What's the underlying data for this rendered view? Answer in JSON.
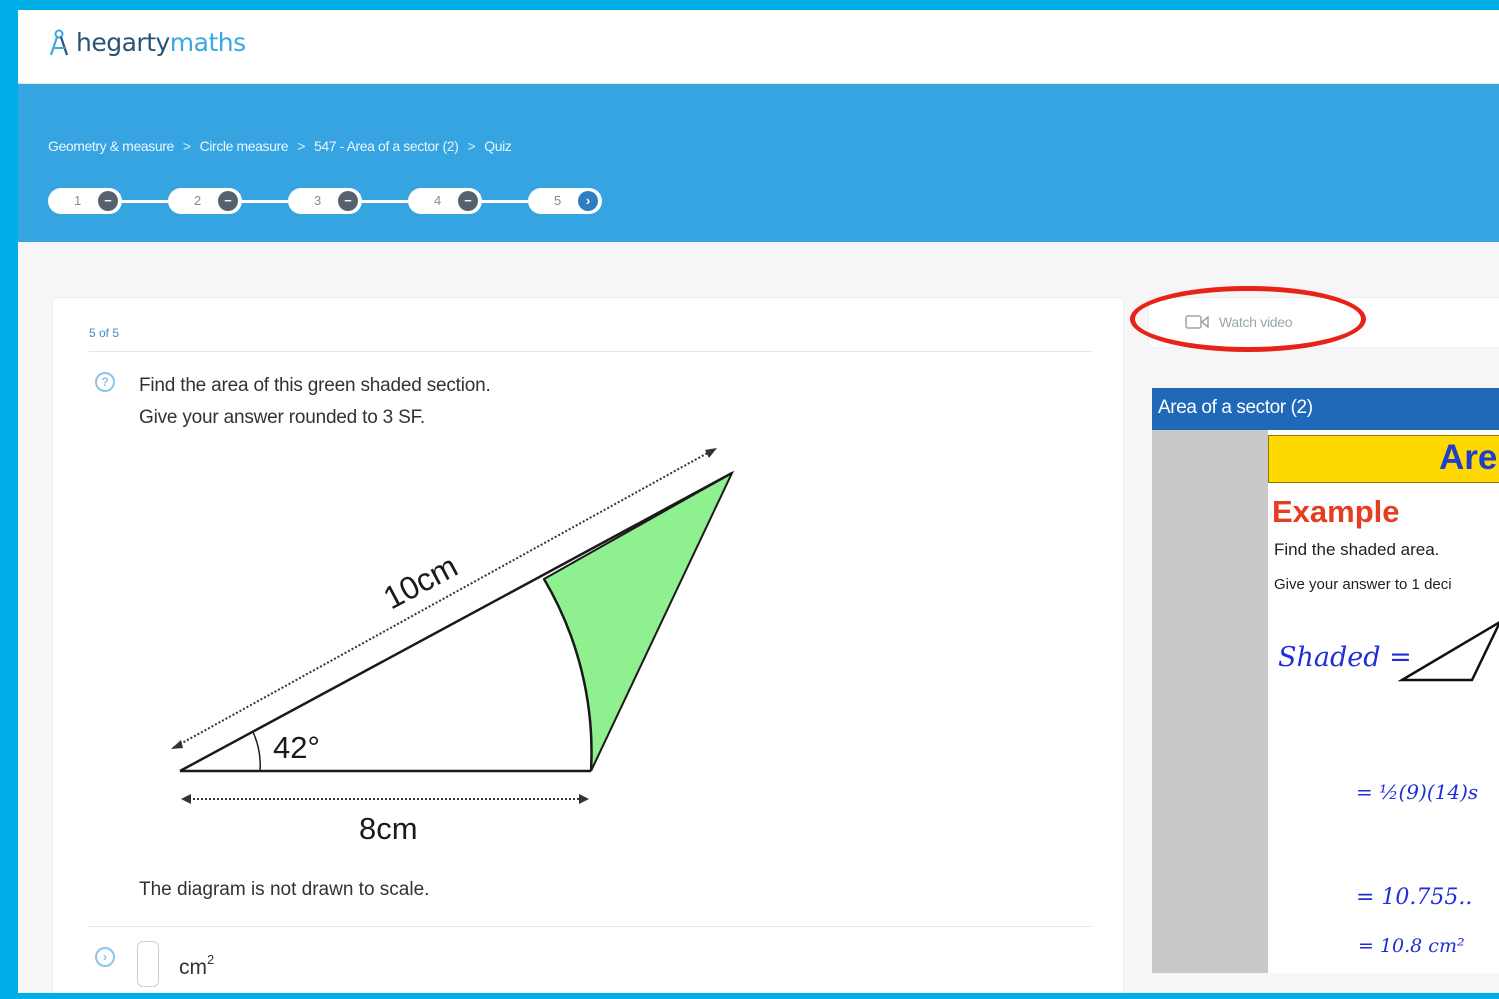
{
  "brand": {
    "part1": "hegarty",
    "part2": "maths"
  },
  "breadcrumb": [
    "Geometry & measure",
    "Circle measure",
    "547 - Area of a sector (2)",
    "Quiz"
  ],
  "breadcrumb_sep": ">",
  "steps": [
    {
      "num": "1",
      "state": "−"
    },
    {
      "num": "2",
      "state": "−"
    },
    {
      "num": "3",
      "state": "−"
    },
    {
      "num": "4",
      "state": "−"
    },
    {
      "num": "5",
      "state": "›"
    }
  ],
  "question": {
    "count": "5 of 5",
    "line1": "Find the area of this green shaded section.",
    "line2": "Give your answer rounded to 3 SF.",
    "label_hyp": "10cm",
    "label_angle": "42°",
    "label_base": "8cm",
    "note": "The diagram is not drawn to scale.",
    "answer_unit": "cm",
    "answer_unit_sup": "2"
  },
  "video": {
    "watch_label": "Watch video",
    "title": "Area of a sector (2)",
    "slide_heading": "Are",
    "example": "Example",
    "line1": "Find the shaded area.",
    "line2": "Give your answer to 1 deci",
    "hw1": "Shaded =",
    "hw2": "= ½(9)(14)s",
    "hw3": "= 10.755..",
    "hw4": "= 10.8 cm²"
  },
  "colors": {
    "accent": "#35a4e0",
    "shade": "#8ef08e",
    "highlight": "#e82216"
  }
}
